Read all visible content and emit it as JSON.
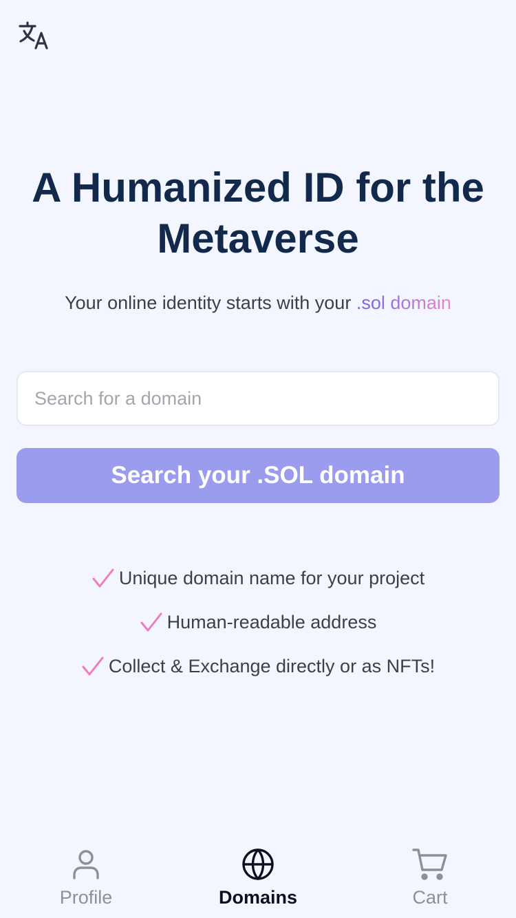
{
  "header": {
    "translate_icon": "translate-icon"
  },
  "hero": {
    "title": "A Humanized ID for the Metaverse",
    "subtitle_prefix": "Your online identity starts with your ",
    "subtitle_accent": ".sol domain",
    "accent_gradient": [
      "#6f63e0",
      "#e58acb"
    ]
  },
  "search": {
    "placeholder": "Search for a domain",
    "value": "",
    "button_label": "Search your .SOL domain",
    "button_color": "#9b9ced"
  },
  "features": [
    {
      "icon": "check-icon",
      "text": "Unique domain name for your project"
    },
    {
      "icon": "check-icon",
      "text": "Human-readable address"
    },
    {
      "icon": "check-icon",
      "text": "Collect & Exchange directly or as NFTs!"
    }
  ],
  "tabbar": {
    "tabs": [
      {
        "icon": "person-icon",
        "label": "Profile",
        "active": false
      },
      {
        "icon": "globe-icon",
        "label": "Domains",
        "active": true
      },
      {
        "icon": "cart-icon",
        "label": "Cart",
        "active": false
      }
    ]
  },
  "colors": {
    "background": "#f3f6fe",
    "title": "#13294b",
    "check": "#f07cc0",
    "tab_inactive": "#8b9099",
    "tab_active": "#0e0f1e"
  }
}
